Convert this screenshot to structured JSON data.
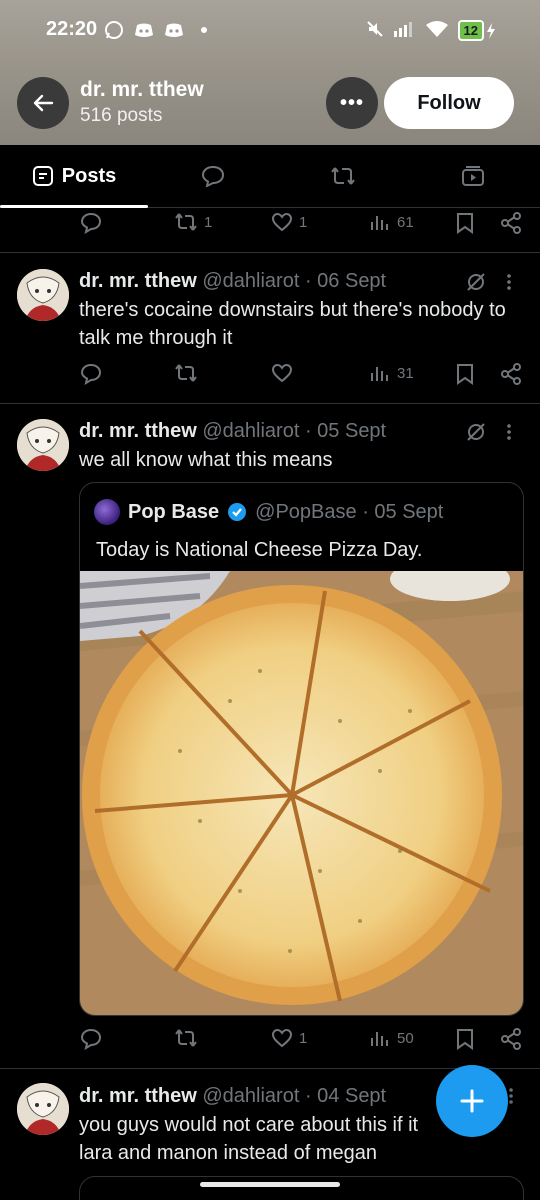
{
  "status_bar": {
    "time": "22:20",
    "battery": "12"
  },
  "profile": {
    "name": "dr. mr. tthew",
    "posts": "516 posts",
    "follow_label": "Follow"
  },
  "tabs": [
    {
      "label": "Posts"
    }
  ],
  "prev_post_actions": {
    "reposts": "1",
    "likes": "1",
    "views": "61"
  },
  "tweets": [
    {
      "name": "dr. mr. tthew",
      "handle_date": "@dahliarot · 06 Sept",
      "text": "there's cocaine downstairs but there's nobody to talk me through it",
      "views": "31"
    },
    {
      "name": "dr. mr. tthew",
      "handle_date": "@dahliarot · 05 Sept",
      "text": "we all know what this means",
      "quote": {
        "name": "Pop Base",
        "handle_date": "@PopBase · 05 Sept",
        "text": "Today is National Cheese Pizza Day."
      },
      "likes": "1",
      "views": "50"
    },
    {
      "name": "dr. mr. tthew",
      "handle_date": "@dahliarot · 04 Sept",
      "text_line1": "you guys would not care about this if it",
      "text_line2": "lara and manon instead of megan"
    }
  ],
  "colors": {
    "accent": "#1d9bf0",
    "verified": "#1d9bf0",
    "background": "#000000",
    "muted": "#71767b"
  },
  "icons": [
    "back-arrow-icon",
    "more-icon",
    "posts-tab-icon",
    "replies-tab-icon",
    "reposts-tab-icon",
    "media-tab-icon",
    "reply-icon",
    "repost-icon",
    "like-icon",
    "views-icon",
    "bookmark-icon",
    "share-icon",
    "grok-icon",
    "plus-icon",
    "verified-badge-icon"
  ]
}
